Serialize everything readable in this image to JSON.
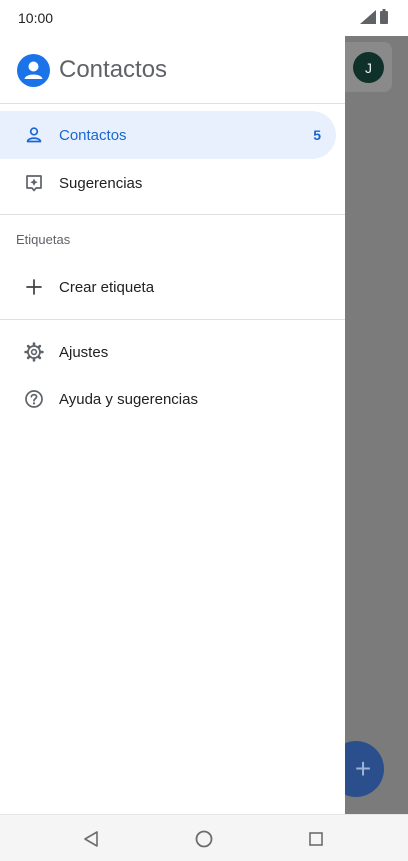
{
  "status_bar": {
    "time": "10:00"
  },
  "drawer": {
    "app_title": "Contactos",
    "items": [
      {
        "label": "Contactos",
        "count": "5",
        "icon": "person-icon",
        "active": true
      },
      {
        "label": "Sugerencias",
        "icon": "suggestions-icon"
      }
    ],
    "labels_section": {
      "heading": "Etiquetas",
      "create_label": "Crear etiqueta"
    },
    "footer_items": [
      {
        "label": "Ajustes",
        "icon": "gear-icon"
      },
      {
        "label": "Ayuda y sugerencias",
        "icon": "help-icon"
      }
    ]
  },
  "background": {
    "avatar_initial": "J",
    "fab_symbol": "+"
  },
  "colors": {
    "accent": "#1967d2",
    "active_bg": "#e8f0fe",
    "logo_blue": "#1a73e8"
  }
}
